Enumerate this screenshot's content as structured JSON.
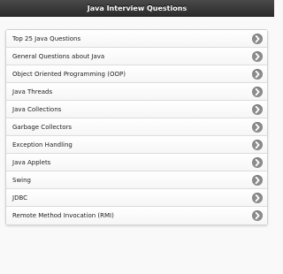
{
  "header": {
    "title": "Java Interview Questions"
  },
  "list": {
    "items": [
      {
        "label": "Top 25 Java Questions",
        "icon": "chevron-right-icon"
      },
      {
        "label": "General Questions about Java",
        "icon": "chevron-right-icon"
      },
      {
        "label": "Object Oriented Programming (OOP)",
        "icon": "chevron-right-icon"
      },
      {
        "label": "Java Threads",
        "icon": "chevron-right-icon"
      },
      {
        "label": "Java Collections",
        "icon": "chevron-right-icon"
      },
      {
        "label": "Garbage Collectors",
        "icon": "chevron-right-icon"
      },
      {
        "label": "Exception Handling",
        "icon": "chevron-right-icon"
      },
      {
        "label": "Java Applets",
        "icon": "chevron-right-icon"
      },
      {
        "label": "Swing",
        "icon": "chevron-right-icon"
      },
      {
        "label": "JDBC",
        "icon": "chevron-right-icon"
      },
      {
        "label": "Remote Method Invocation (RMI)",
        "icon": "chevron-right-icon"
      }
    ]
  },
  "colors": {
    "header_bg": "#333333",
    "icon_bg": "#8c8c8c"
  }
}
